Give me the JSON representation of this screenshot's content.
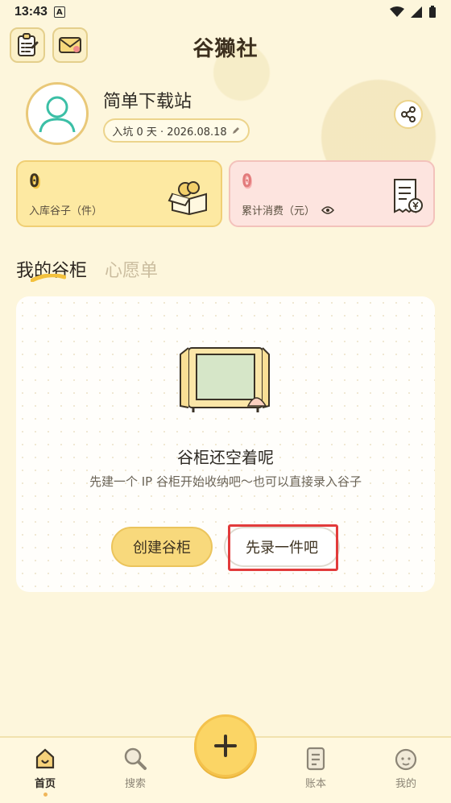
{
  "status_bar": {
    "time": "13:43",
    "a_badge": "A"
  },
  "app": {
    "title": "谷獭社"
  },
  "header": {
    "left_icons": [
      "checklist-icon",
      "mail-icon"
    ]
  },
  "profile": {
    "name": "简单下载站",
    "join_text": "入坑 0 天 · 2026.08.18",
    "share_icon": "share-icon"
  },
  "stats": {
    "collected": {
      "value": "0",
      "label": "入库谷子（件）"
    },
    "spent": {
      "value": "0",
      "label": "累计消费（元）"
    }
  },
  "tabs": [
    {
      "label": "我的谷柜",
      "active": true
    },
    {
      "label": "心愿单",
      "active": false
    }
  ],
  "empty_state": {
    "title": "谷柜还空着呢",
    "description": "先建一个 IP 谷柜开始收纳吧～也可以直接录入谷子",
    "primary_button": "创建谷柜",
    "secondary_button": "先录一件吧"
  },
  "bottom_nav": {
    "items": [
      {
        "label": "首页",
        "icon": "home-icon",
        "active": true
      },
      {
        "label": "搜索",
        "icon": "search-icon",
        "active": false
      },
      {
        "label": "账本",
        "icon": "ledger-icon",
        "active": false
      },
      {
        "label": "我的",
        "icon": "profile-icon",
        "active": false
      }
    ],
    "fab_icon": "plus-icon"
  },
  "colors": {
    "background": "#fdf6dc",
    "accent_yellow": "#f8d97c",
    "accent_pink": "#fde4df",
    "highlight_red": "#e23b3b"
  }
}
